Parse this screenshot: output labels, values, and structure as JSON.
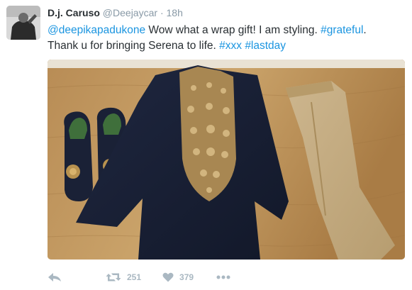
{
  "tweet": {
    "author_name": "D.j. Caruso",
    "author_handle": "@Deejaycar",
    "separator": "·",
    "time": "18h",
    "text_parts": [
      {
        "text": "@deepikapadukone",
        "kind": "mention"
      },
      {
        "text": " Wow what a wrap gift! I am styling. ",
        "kind": "plain"
      },
      {
        "text": "#grateful",
        "kind": "hashtag"
      },
      {
        "text": ".",
        "kind": "plain"
      },
      {
        "text": "\nThank u for bringing Serena to life. ",
        "kind": "plain"
      },
      {
        "text": "#xxx",
        "kind": "hashtag"
      },
      {
        "text": " ",
        "kind": "plain"
      },
      {
        "text": "#lastday",
        "kind": "hashtag"
      }
    ]
  },
  "actions": {
    "reply_icon": "reply-icon",
    "retweet_icon": "retweet-icon",
    "retweet_count": "251",
    "like_icon": "heart-icon",
    "like_count": "379",
    "more_icon": "more-dots-icon"
  },
  "colors": {
    "link": "#1b95e0",
    "muted": "#8899a6",
    "action_gray": "#aab8c2"
  }
}
